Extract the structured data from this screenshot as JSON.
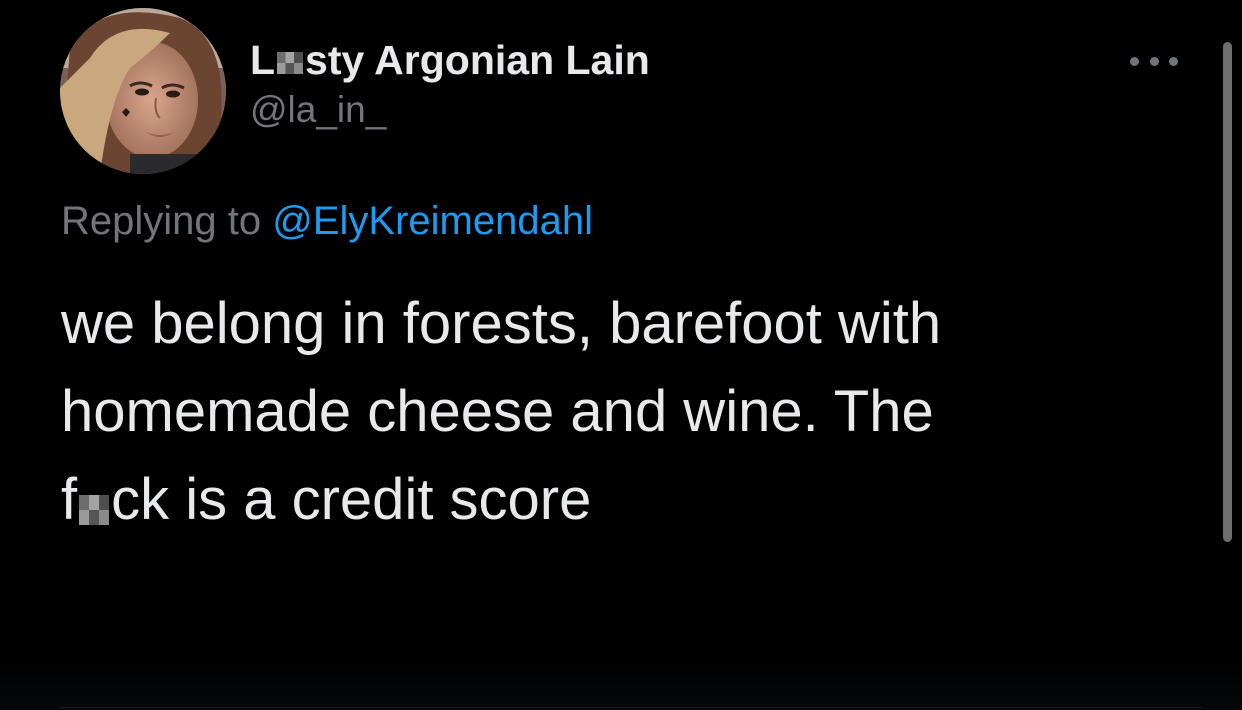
{
  "tweet": {
    "author": {
      "display_name_start": "L",
      "display_name_end": "sty Argonian Lain",
      "handle": "@la_in_"
    },
    "replying_prefix": "Replying to ",
    "replying_mention": "@ElyKreimendahl",
    "text_lines": [
      "we belong in forests, barefoot with",
      "homemade cheese and wine. The"
    ],
    "last_line_start": "f",
    "last_line_end": "ck is a credit score"
  },
  "icons": {
    "avatar": "profile-photo",
    "more": "more-options-icon"
  },
  "colors": {
    "background": "#000000",
    "primary_text": "#e7e9ea",
    "secondary_text": "#71767b",
    "accent": "#1d9bf0"
  }
}
